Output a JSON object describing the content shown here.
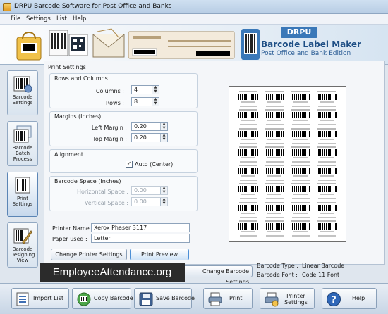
{
  "window": {
    "title": "DRPU Barcode Software for Post Office and Banks"
  },
  "menu": [
    "File",
    "Settings",
    "List",
    "Help"
  ],
  "banner": {
    "logo_text": "DRPU",
    "product": "Barcode Label Maker",
    "edition": "Post Office and Bank Edition"
  },
  "sidebar": [
    {
      "label": "Barcode Settings",
      "icon": "barcode-settings-icon"
    },
    {
      "label": "Barcode Batch Process",
      "icon": "batch-process-icon"
    },
    {
      "label": "Print Settings",
      "icon": "print-settings-icon",
      "active": true
    },
    {
      "label": "Barcode Designing View",
      "icon": "designing-view-icon"
    }
  ],
  "print_settings": {
    "title": "Print Settings",
    "rows_columns": {
      "title": "Rows and Columns",
      "columns_label": "Columns :",
      "columns": "4",
      "rows_label": "Rows :",
      "rows": "8"
    },
    "margins": {
      "title": "Margins (Inches)",
      "left_label": "Left Margin :",
      "left": "0.20",
      "top_label": "Top Margin :",
      "top": "0.20"
    },
    "alignment": {
      "title": "Alignment",
      "auto_label": "Auto (Center)",
      "checked": true
    },
    "barcode_space": {
      "title": "Barcode Space (Inches)",
      "h_label": "Horizontal Space :",
      "h": "0.00",
      "v_label": "Vertical Space :",
      "v": "0.00"
    },
    "printer_name_label": "Printer Name :",
    "printer_name": "Xerox Phaser 3117",
    "paper_label": "Paper used :",
    "paper": "Letter",
    "change_printer_btn": "Change Printer Settings",
    "print_preview_btn": "Print Preview",
    "change_barcode_btn": "Change Barcode Settings"
  },
  "preview": {
    "columns": 4,
    "rows": 8
  },
  "barcode_info": {
    "type_label": "Barcode Type :",
    "type": "Linear Barcode",
    "font_label": "Barcode Font :",
    "font": "Code 11 Font"
  },
  "watermark": "EmployeeAttendance.org",
  "toolbar": {
    "import_list": "Import List",
    "copy_barcode": "Copy Barcode",
    "save_barcode": "Save Barcode",
    "print": "Print",
    "printer_settings_1": "Printer",
    "printer_settings_2": "Settings",
    "help": "Help"
  }
}
